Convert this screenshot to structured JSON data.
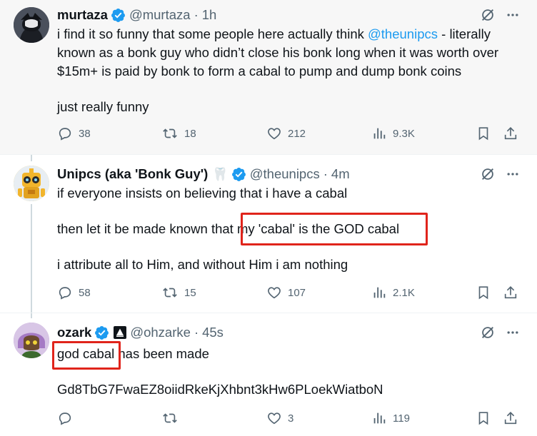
{
  "tweets": [
    {
      "name": "murtaza",
      "handle": "@murtaza",
      "sep": "·",
      "time": "1h",
      "text_a": "i find it so funny that some people here actually think ",
      "mention": "@theunipcs",
      "text_b": " - literally",
      "line2": "known as a bonk guy who didn’t close his bonk long when it was worth over",
      "line3": "$15m+ is paid by bonk to form a cabal to pump and dump bonk coins",
      "line4": "just really funny",
      "replies": "38",
      "reposts": "18",
      "likes": "212",
      "views": "9.3K"
    },
    {
      "name": "Unipcs (aka 'Bonk Guy')",
      "badge_emoji": "🦷",
      "handle": "@theunipcs",
      "sep": "·",
      "time": "4m",
      "line1": "if everyone insists on believing that i have a cabal",
      "line2a": "then let it be made known that ",
      "line2b": "my 'cabal' is the GOD cabal",
      "line3": "i attribute all to Him, and without Him i am nothing",
      "replies": "58",
      "reposts": "15",
      "likes": "107",
      "views": "2.1K"
    },
    {
      "name": "ozark",
      "handle": "@ohzarke",
      "sep": "·",
      "time": "45s",
      "line1a": "god cabal",
      "line1b": " has been made",
      "line2": "Gd8TbG7FwaEZ8oiidRkeKjXhbnt3kHw6PLoekWiatboN",
      "likes": "3",
      "views": "119"
    }
  ],
  "colors": {
    "text": "#0f1419",
    "secondary": "#536471",
    "link": "#1d9bf0",
    "verified": "#1d9bf0",
    "highlight_box": "#e0241b"
  },
  "icons": [
    "verified-badge-icon",
    "grok-icon",
    "more-icon",
    "reply-icon",
    "repost-icon",
    "like-icon",
    "views-icon",
    "bookmark-icon",
    "share-icon",
    "affiliate-badge-icon"
  ]
}
